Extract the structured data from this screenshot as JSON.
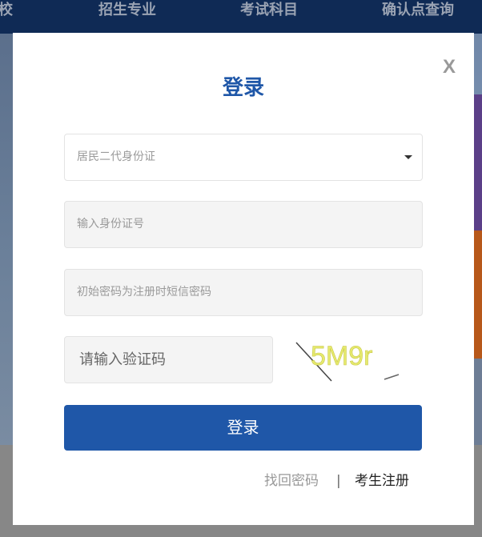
{
  "nav": {
    "items": [
      "校",
      "招生专业",
      "考试科目",
      "确认点查询"
    ]
  },
  "login": {
    "close_label": "X",
    "title": "登录",
    "id_type": {
      "selected": "居民二代身份证"
    },
    "id_number": {
      "placeholder": "输入身份证号"
    },
    "password": {
      "placeholder": "初始密码为注册时短信密码"
    },
    "captcha": {
      "placeholder": "请输入验证码",
      "code": "5M9r"
    },
    "submit_label": "登录",
    "forgot_label": "找回密码",
    "separator": "|",
    "register_label": "考生注册"
  },
  "colors": {
    "primary": "#1f57a8",
    "nav_bg": "#0f2a55",
    "captcha_text": "#e6ea6e"
  }
}
